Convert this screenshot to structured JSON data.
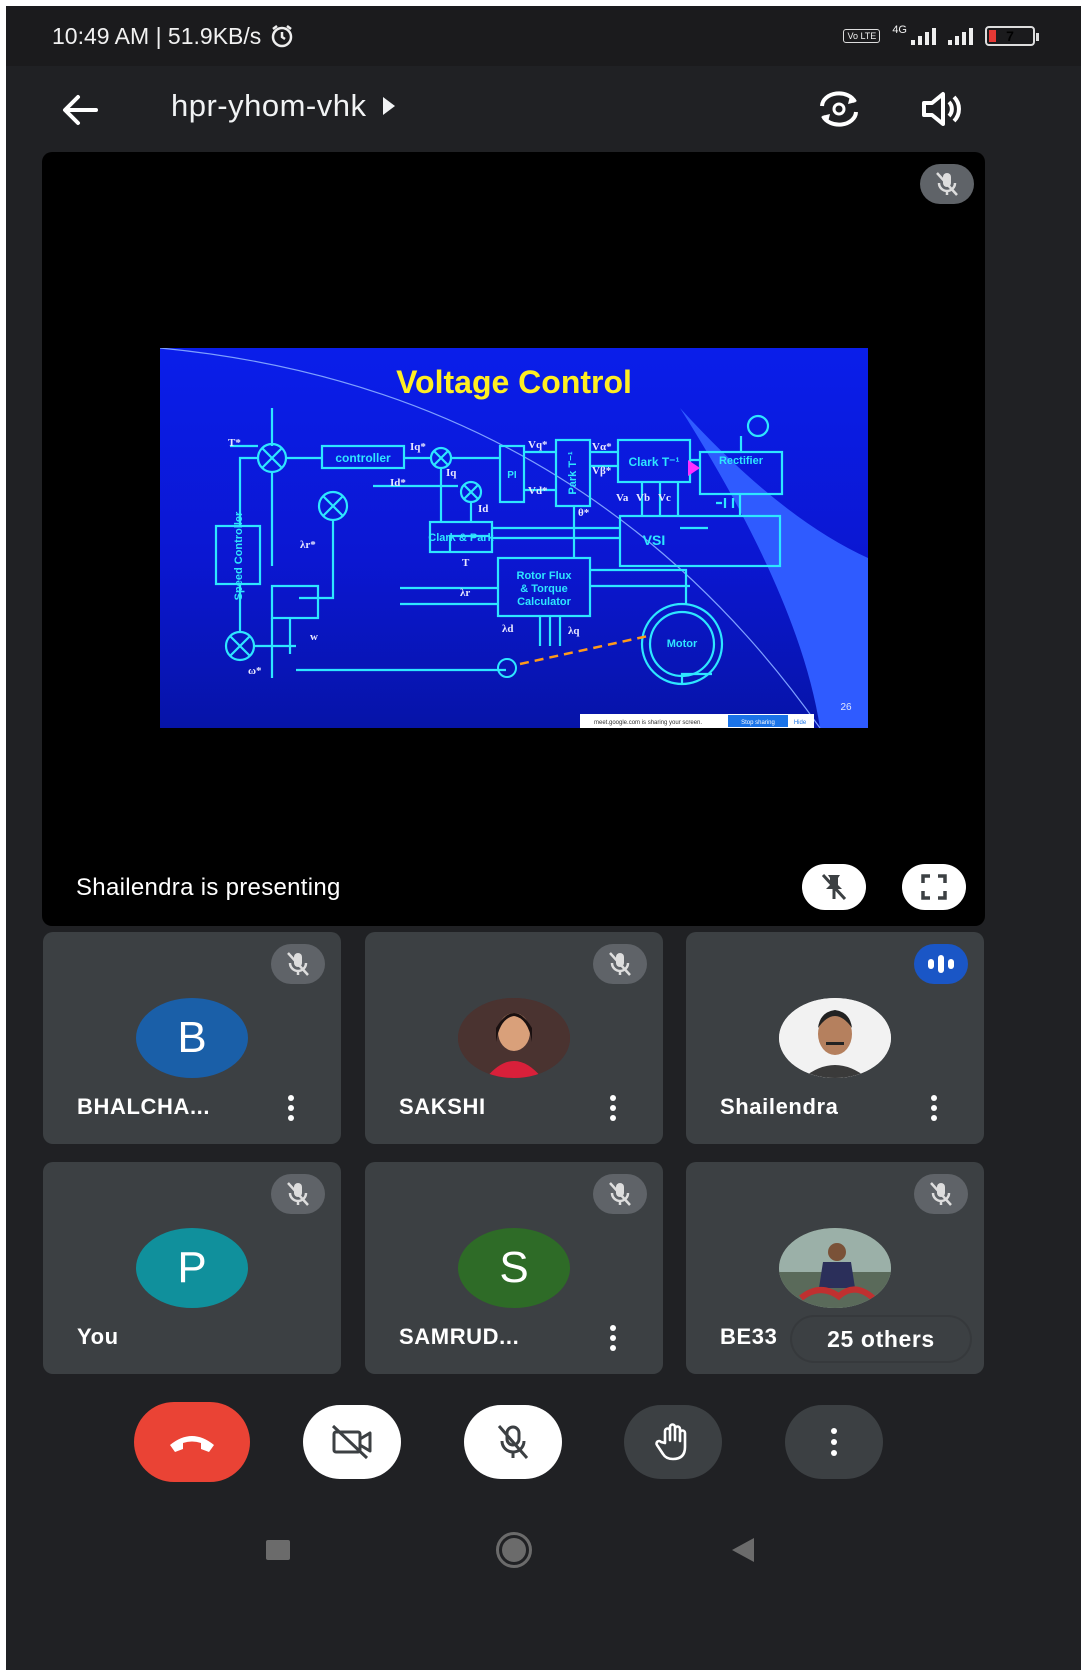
{
  "status_bar": {
    "time_speed": "10:49 AM | 51.9KB/s",
    "network_label": "4G",
    "volte_label": "Vo LTE",
    "battery_level": "7"
  },
  "app_bar": {
    "meeting_code": "hpr-yhom-vhk",
    "icons": [
      "back-arrow-icon",
      "switch-camera-icon",
      "speaker-icon"
    ]
  },
  "presentation": {
    "status_text": "Shailendra is presenting",
    "slide": {
      "title": "Voltage Control",
      "page_number": "26",
      "blocks": {
        "controller": "controller",
        "pi": "PI",
        "park_inv": "Park T⁻¹",
        "clark_inv": "Clark T⁻¹",
        "rectifier": "Rectifier",
        "clark_park": "Clark & Park",
        "vsi": "VSI",
        "speed_controller": "Speed Controller",
        "rotor_flux_line1": "Rotor Flux",
        "rotor_flux_line2": "& Torque",
        "rotor_flux_line3": "Calculator",
        "motor": "Motor"
      },
      "signals": {
        "t_ref": "T*",
        "iq_ref": "Iq*",
        "id_ref": "Id*",
        "iq": "Iq",
        "id": "Id",
        "vq_ref": "Vq*",
        "vd_ref": "Vd*",
        "va_ref": "Vα*",
        "vb_ref": "Vβ*",
        "theta": "θ*",
        "va": "Va",
        "vb": "Vb",
        "vc": "Vc",
        "lambda_r_ref": "λr*",
        "lambda_r": "λr",
        "t": "T",
        "w": "w",
        "omega_ref": "ω*",
        "lambda_d": "λd",
        "lambda_q": "λq"
      },
      "sharing_bar": {
        "text": "meet.google.com is sharing your screen.",
        "stop_label": "Stop sharing",
        "hide_label": "Hide"
      }
    }
  },
  "participants": [
    {
      "name": "BHALCHA...",
      "initial": "B",
      "color": "#1a5fa8",
      "muted": true
    },
    {
      "name": "SAKSHI",
      "initial": "",
      "color": "#8a3b3b",
      "muted": true
    },
    {
      "name": "Shailendra",
      "initial": "",
      "color": "#ddd",
      "muted": false,
      "speaking": true
    },
    {
      "name": "You",
      "initial": "P",
      "color": "#10909c",
      "muted": true
    },
    {
      "name": "SAMRUD...",
      "initial": "S",
      "color": "#2e6b27",
      "muted": true
    },
    {
      "name": "BE33",
      "initial": "",
      "color": "#6a7a6a",
      "muted": true
    }
  ],
  "others_pill": "25 others",
  "controls": {
    "icons": [
      "end-call-icon",
      "camera-off-icon",
      "mic-off-icon",
      "raise-hand-icon",
      "more-options-icon"
    ]
  }
}
